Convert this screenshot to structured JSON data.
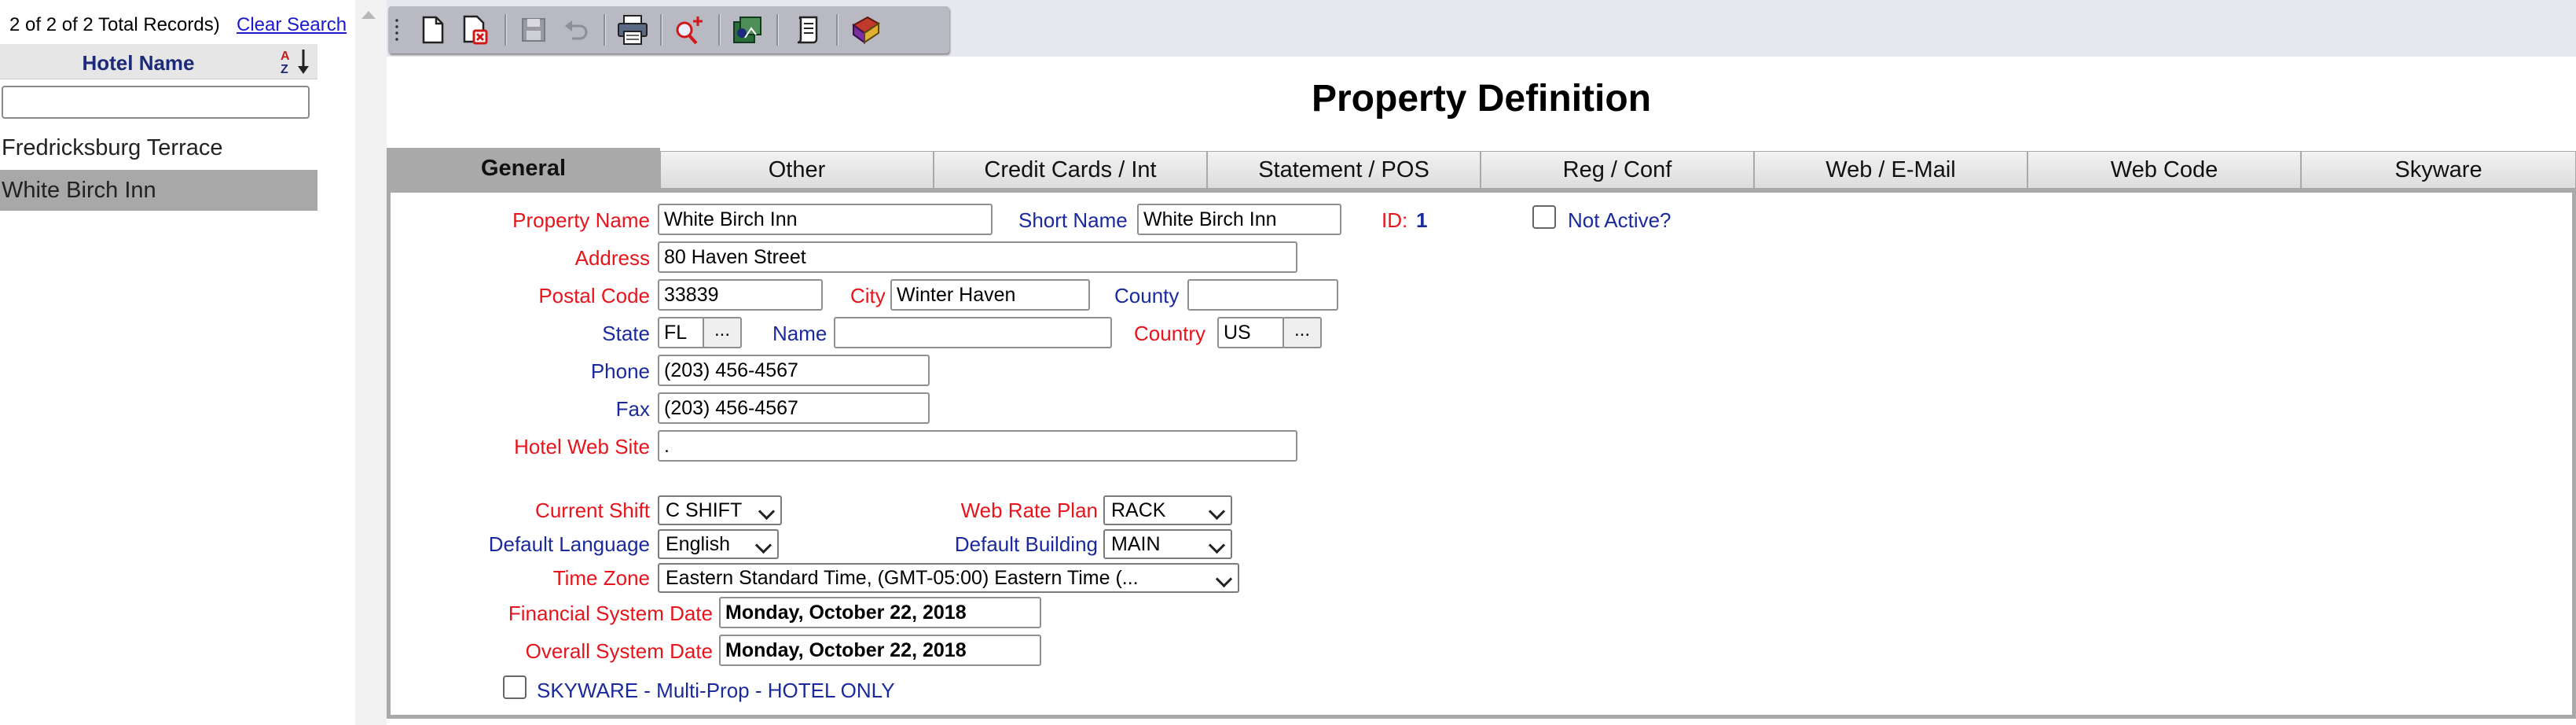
{
  "records": {
    "info": "2 of 2 of 2 Total Records)",
    "clear_search": "Clear Search"
  },
  "hotel_list": {
    "header": "Hotel Name",
    "filter_value": "",
    "items": [
      "Fredricksburg Terrace",
      "White Birch Inn"
    ],
    "selected": "White Birch Inn"
  },
  "toolbar": {
    "buttons": [
      "new-document-icon",
      "delete-document-icon",
      "save-icon",
      "undo-icon",
      "print-icon",
      "search-add-icon",
      "report-icon",
      "scroll-icon",
      "book-icon"
    ]
  },
  "title": "Property Definition",
  "tabs": [
    "General",
    "Other",
    "Credit Cards / Int",
    "Statement / POS",
    "Reg / Conf",
    "Web / E-Mail",
    "Web Code",
    "Skyware"
  ],
  "active_tab": "General",
  "form": {
    "labels": {
      "property_name": "Property Name",
      "short_name": "Short Name",
      "id": "ID:",
      "not_active": "Not Active?",
      "address": "Address",
      "postal_code": "Postal Code",
      "city": "City",
      "county": "County",
      "state": "State",
      "name": "Name",
      "country": "Country",
      "phone": "Phone",
      "fax": "Fax",
      "hotel_web_site": "Hotel Web Site",
      "current_shift": "Current Shift",
      "web_rate_plan": "Web Rate Plan",
      "default_language": "Default Language",
      "default_building": "Default Building",
      "time_zone": "Time Zone",
      "financial_system_date": "Financial System Date",
      "overall_system_date": "Overall System Date",
      "skyware": "SKYWARE - Multi-Prop - HOTEL ONLY"
    },
    "values": {
      "property_name": "White Birch Inn",
      "short_name": "White Birch Inn",
      "id": "1",
      "address": "80 Haven Street",
      "postal_code": "33839",
      "city": "Winter Haven",
      "county": "",
      "state": "FL",
      "name": "",
      "country": "US",
      "phone": "(203) 456-4567",
      "fax": "(203) 456-4567",
      "hotel_web_site": ".",
      "current_shift": "C SHIFT",
      "web_rate_plan": "RACK",
      "default_language": "English",
      "default_building": "MAIN",
      "time_zone": "Eastern Standard Time, (GMT-05:00) Eastern Time (...",
      "financial_system_date": "Monday, October 22, 2018",
      "overall_system_date": "Monday, October 22, 2018"
    },
    "ellipsis": "...",
    "not_active_checked": false,
    "skyware_checked": false
  },
  "colors": {
    "required_label": "#e8141c",
    "optional_label": "#1a2a9c",
    "selected_row": "#a8a8a8",
    "toolbar": "#b8b9c2"
  }
}
